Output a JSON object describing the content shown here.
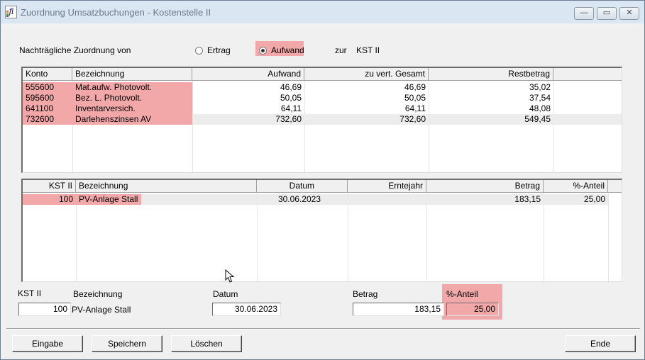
{
  "window": {
    "icon_text": "fi",
    "title": "Zuordnung Umsatzbuchungen - Kostenstelle II",
    "controls": {
      "minimize": "—",
      "maximize": "▭",
      "close": "✕"
    }
  },
  "assignment": {
    "label": "Nachträgliche Zuordnung von",
    "option_ertrag": "Ertrag",
    "option_aufwand": "Aufwand",
    "selected": "Aufwand",
    "zur_label": "zur",
    "kst_label": "KST II"
  },
  "accounts_table": {
    "headers": [
      "Konto",
      "Bezeichnung",
      "Aufwand",
      "zu vert. Gesamt",
      "Restbetrag"
    ],
    "rows": [
      [
        "555600",
        "Mat.aufw. Photovolt.",
        "46,69",
        "46,69",
        "35,02"
      ],
      [
        "595600",
        "Bez. L. Photovolt.",
        "50,05",
        "50,05",
        "37,54"
      ],
      [
        "641100",
        "Inventarversich.",
        "64,11",
        "64,11",
        "48,08"
      ],
      [
        "732600",
        "Darlehenszinsen AV",
        "732,60",
        "732,60",
        "549,45"
      ]
    ]
  },
  "kst_table": {
    "headers": [
      "KST II",
      "Bezeichnung",
      "Datum",
      "Erntejahr",
      "Betrag",
      "%-Anteil"
    ],
    "rows": [
      [
        "100",
        "PV-Anlage Stall",
        "30.06.2023",
        "",
        "183,15",
        "25,00"
      ]
    ]
  },
  "form": {
    "kst_label": "KST II",
    "kst_value": "100",
    "bezeichnung_label": "Bezeichnung",
    "bezeichnung_value": "PV-Anlage Stall",
    "datum_label": "Datum",
    "datum_value": "30.06.2023",
    "betrag_label": "Betrag",
    "betrag_value": "183,15",
    "anteil_label": "%-Anteil",
    "anteil_value": "25,00"
  },
  "buttons": {
    "eingabe": "Eingabe",
    "speichern": "Speichern",
    "loeschen": "Löschen",
    "ende": "Ende"
  },
  "colors": {
    "highlight": "#f2a8a8",
    "titlebar": "#dae6f2"
  }
}
